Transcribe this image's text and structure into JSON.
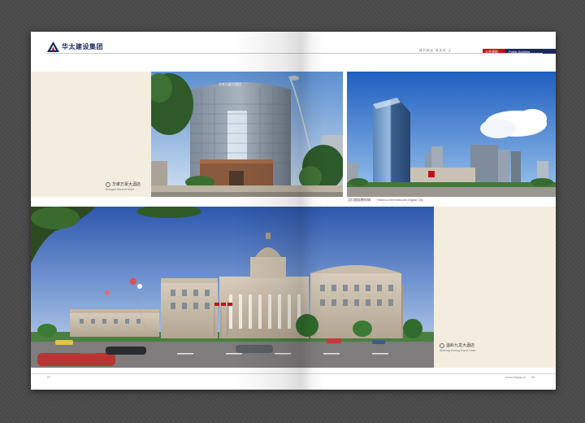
{
  "header": {
    "company": "华太建设集团",
    "tagline": "建的精品   筑永恒  主",
    "section_cn": "公共建筑",
    "section_en": "Public Building"
  },
  "photos": [
    {
      "building_sign": "华孝万豪大酒店",
      "caption_cn": "华孝万豪大酒店",
      "caption_en": "Xiaogan Marriott Hotel"
    },
    {
      "caption_cn": "汉口国际数码城",
      "caption_en": "Hankou International Digital City"
    },
    {
      "caption_cn": "温岭九龙大酒店",
      "caption_en": "Wenling Jiulong Grand Hotel"
    }
  ],
  "footer": {
    "page_left": "37",
    "website": "www.hhjygl.cn",
    "page_right": "38"
  },
  "colors": {
    "brand_navy": "#1a2a5a",
    "accent_red": "#c0141b",
    "cream": "#f3ede0"
  }
}
